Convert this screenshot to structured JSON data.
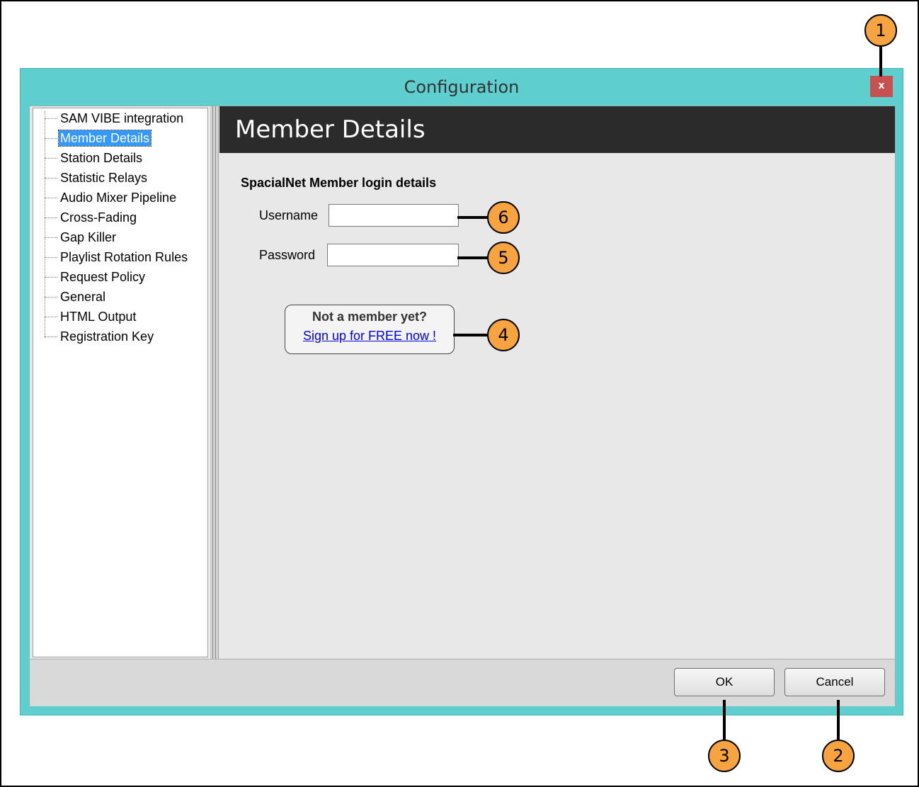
{
  "window": {
    "title": "Configuration",
    "close_label": "x"
  },
  "sidebar": {
    "items": [
      {
        "label": "SAM VIBE integration",
        "selected": false
      },
      {
        "label": "Member Details",
        "selected": true
      },
      {
        "label": "Station Details",
        "selected": false
      },
      {
        "label": "Statistic Relays",
        "selected": false
      },
      {
        "label": "Audio Mixer Pipeline",
        "selected": false
      },
      {
        "label": "Cross-Fading",
        "selected": false
      },
      {
        "label": "Gap Killer",
        "selected": false
      },
      {
        "label": "Playlist Rotation Rules",
        "selected": false
      },
      {
        "label": "Request Policy",
        "selected": false
      },
      {
        "label": "General",
        "selected": false
      },
      {
        "label": "HTML Output",
        "selected": false
      },
      {
        "label": "Registration Key",
        "selected": false
      }
    ]
  },
  "panel": {
    "header": "Member Details",
    "section_title": "SpacialNet Member login details",
    "username_label": "Username",
    "username_value": "",
    "password_label": "Password",
    "password_value": "",
    "member_prompt": "Not a member yet?",
    "signup_link": "Sign up for FREE now !"
  },
  "footer": {
    "ok_label": "OK",
    "cancel_label": "Cancel"
  },
  "callouts": {
    "c1": "1",
    "c2": "2",
    "c3": "3",
    "c4": "4",
    "c5": "5",
    "c6": "6"
  },
  "colors": {
    "window_frame": "#5ecece",
    "header_bg": "#2b2b2b",
    "close_button": "#c75050",
    "callout": "#f7a440",
    "selection": "#3399ff"
  }
}
